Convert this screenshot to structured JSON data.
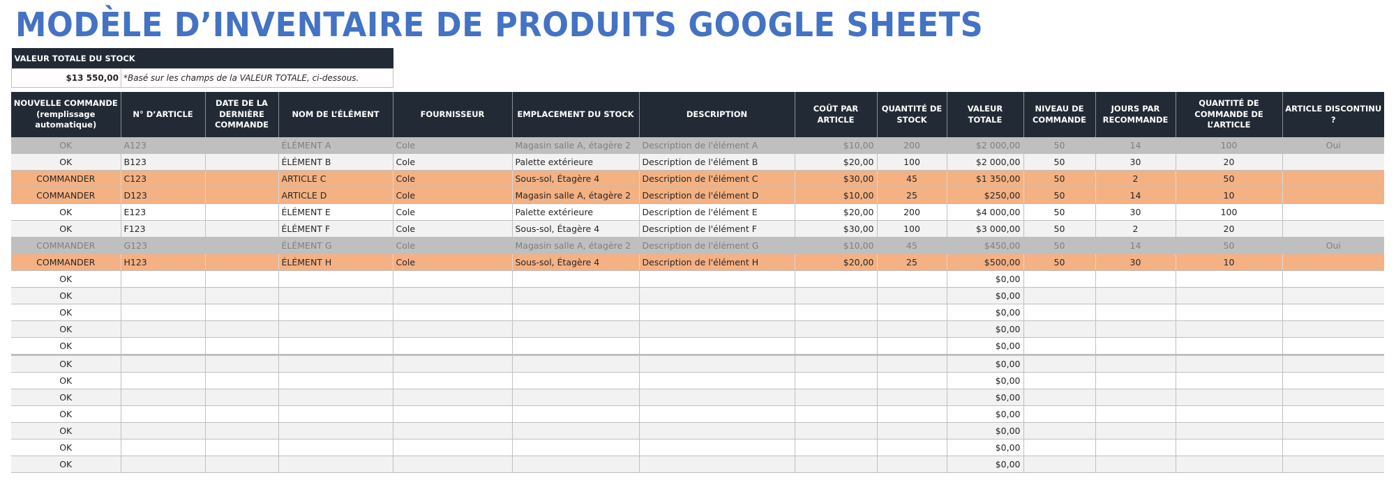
{
  "title": "MODÈLE D’INVENTAIRE DE PRODUITS GOOGLE SHEETS",
  "summary": {
    "label": "VALEUR TOTALE DU STOCK",
    "value": "$13 550,00",
    "note": "*Basé sur les champs de la VALEUR TOTALE, ci-dessous."
  },
  "colors": {
    "title": "#4472c4",
    "header_bg": "#222a35",
    "discontinued_row": "#bfbfbf",
    "reorder_row": "#f4b183",
    "alt_row": "#f2f2f2"
  },
  "table": {
    "headers": [
      "NOUVELLE COMMANDE (remplissage automatique)",
      "N° D’ARTICLE",
      "DATE DE LA DERNIÈRE COMMANDE",
      "NOM DE L’ÉLÉMENT",
      "FOURNISSEUR",
      "EMPLACEMENT DU STOCK",
      "DESCRIPTION",
      "COÛT PAR ARTICLE",
      "QUANTITÉ DE STOCK",
      "VALEUR TOTALE",
      "NIVEAU DE COMMANDE",
      "JOURS PAR RECOMMANDE",
      "QUANTITÉ DE COMMANDE DE L’ARTICLE",
      "ARTICLE DISCONTINU ?"
    ],
    "rows": [
      {
        "style": "disc",
        "cells": [
          "OK",
          "A123",
          "",
          "ÉLÉMENT A",
          "Cole",
          "Magasin salle A, étagère 2",
          "Description de l'élément A",
          "$10,00",
          "200",
          "$2 000,00",
          "50",
          "14",
          "100",
          "Oui"
        ]
      },
      {
        "style": "light",
        "cells": [
          "OK",
          "B123",
          "",
          "ÉLÉMENT B",
          "Cole",
          "Palette extérieure",
          "Description de l'élément B",
          "$20,00",
          "100",
          "$2 000,00",
          "50",
          "30",
          "20",
          ""
        ]
      },
      {
        "style": "order",
        "cells": [
          "COMMANDER",
          "C123",
          "",
          "ARTICLE C",
          "Cole",
          "Sous-sol, Étagère 4",
          "Description de l'élément C",
          "$30,00",
          "45",
          "$1 350,00",
          "50",
          "2",
          "50",
          ""
        ]
      },
      {
        "style": "order",
        "cells": [
          "COMMANDER",
          "D123",
          "",
          "ARTICLE D",
          "Cole",
          "Magasin salle A, étagère 2",
          "Description de l'élément D",
          "$10,00",
          "25",
          "$250,00",
          "50",
          "14",
          "10",
          ""
        ]
      },
      {
        "style": "white",
        "cells": [
          "OK",
          "E123",
          "",
          "ÉLÉMENT E",
          "Cole",
          "Palette extérieure",
          "Description de l'élément E",
          "$20,00",
          "200",
          "$4 000,00",
          "50",
          "30",
          "100",
          ""
        ]
      },
      {
        "style": "light",
        "cells": [
          "OK",
          "F123",
          "",
          "ÉLÉMENT F",
          "Cole",
          "Sous-sol, Étagère 4",
          "Description de l'élément F",
          "$30,00",
          "100",
          "$3 000,00",
          "50",
          "2",
          "20",
          ""
        ]
      },
      {
        "style": "disc",
        "cells": [
          "COMMANDER",
          "G123",
          "",
          "ÉLÉMENT G",
          "Cole",
          "Magasin salle A, étagère 2",
          "Description de l'élément G",
          "$10,00",
          "45",
          "$450,00",
          "50",
          "14",
          "50",
          "Oui"
        ]
      },
      {
        "style": "order",
        "cells": [
          "COMMANDER",
          "H123",
          "",
          "ÉLÉMENT H",
          "Cole",
          "Sous-sol, Étagère 4",
          "Description de l'élément H",
          "$20,00",
          "25",
          "$500,00",
          "50",
          "30",
          "10",
          ""
        ]
      },
      {
        "style": "white",
        "cells": [
          "OK",
          "",
          "",
          "",
          "",
          "",
          "",
          "",
          "",
          "$0,00",
          "",
          "",
          "",
          ""
        ]
      },
      {
        "style": "light",
        "cells": [
          "OK",
          "",
          "",
          "",
          "",
          "",
          "",
          "",
          "",
          "$0,00",
          "",
          "",
          "",
          ""
        ]
      },
      {
        "style": "white",
        "cells": [
          "OK",
          "",
          "",
          "",
          "",
          "",
          "",
          "",
          "",
          "$0,00",
          "",
          "",
          "",
          ""
        ]
      },
      {
        "style": "light",
        "cells": [
          "OK",
          "",
          "",
          "",
          "",
          "",
          "",
          "",
          "",
          "$0,00",
          "",
          "",
          "",
          ""
        ]
      },
      {
        "style": "white",
        "cells": [
          "OK",
          "",
          "",
          "",
          "",
          "",
          "",
          "",
          "",
          "$0,00",
          "",
          "",
          "",
          ""
        ]
      },
      {
        "style": "light",
        "cells": [
          "OK",
          "",
          "",
          "",
          "",
          "",
          "",
          "",
          "",
          "$0,00",
          "",
          "",
          "",
          ""
        ]
      },
      {
        "style": "white",
        "cells": [
          "OK",
          "",
          "",
          "",
          "",
          "",
          "",
          "",
          "",
          "$0,00",
          "",
          "",
          "",
          ""
        ]
      },
      {
        "style": "light",
        "cells": [
          "OK",
          "",
          "",
          "",
          "",
          "",
          "",
          "",
          "",
          "$0,00",
          "",
          "",
          "",
          ""
        ]
      },
      {
        "style": "white",
        "cells": [
          "OK",
          "",
          "",
          "",
          "",
          "",
          "",
          "",
          "",
          "$0,00",
          "",
          "",
          "",
          ""
        ]
      },
      {
        "style": "light",
        "cells": [
          "OK",
          "",
          "",
          "",
          "",
          "",
          "",
          "",
          "",
          "$0,00",
          "",
          "",
          "",
          ""
        ]
      },
      {
        "style": "white",
        "cells": [
          "OK",
          "",
          "",
          "",
          "",
          "",
          "",
          "",
          "",
          "$0,00",
          "",
          "",
          "",
          ""
        ]
      },
      {
        "style": "light",
        "cells": [
          "OK",
          "",
          "",
          "",
          "",
          "",
          "",
          "",
          "",
          "$0,00",
          "",
          "",
          "",
          ""
        ]
      }
    ]
  }
}
